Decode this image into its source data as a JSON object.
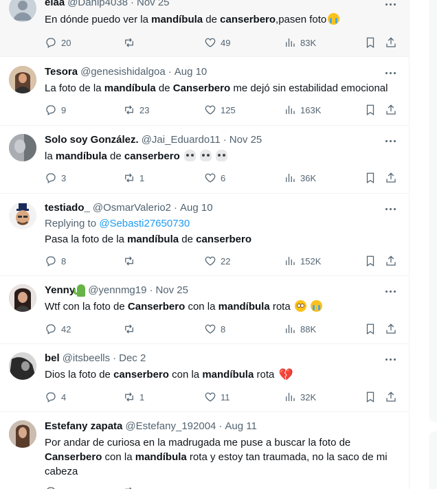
{
  "tweets": [
    {
      "name": "elaa",
      "handle": "@Danip4038",
      "date": "Nov 25",
      "text_parts": [
        "En dónde puedo ver la ",
        "mandíbula",
        " de ",
        "canserbero",
        ",pasen foto"
      ],
      "emoji": [
        "loudly-crying-face"
      ],
      "replies": "20",
      "retweets": "",
      "likes": "49",
      "views": "83K"
    },
    {
      "name": "Tesora",
      "handle": "@genesishidalgoa",
      "date": "Aug 10",
      "text_parts": [
        "La foto de la ",
        "mandíbula",
        " de ",
        "Canserbero",
        " me dejó sin estabilidad emocional"
      ],
      "replies": "9",
      "retweets": "23",
      "likes": "125",
      "views": "163K"
    },
    {
      "name": "Solo soy González.",
      "handle": "@Jai_Eduardo11",
      "date": "Nov 25",
      "text_parts": [
        "la ",
        "mandíbula",
        " de ",
        "canserbero",
        " "
      ],
      "emoji": [
        "skull",
        "skull",
        "skull"
      ],
      "replies": "3",
      "retweets": "1",
      "likes": "6",
      "views": "36K"
    },
    {
      "name": "testiado_",
      "handle": "@OsmarValerio2",
      "date": "Aug 10",
      "replying_label": "Replying to",
      "replying_to": "@Sebasti27650730",
      "text_parts": [
        "Pasa la foto de la ",
        "mandíbula",
        " de ",
        "canserbero",
        ""
      ],
      "replies": "8",
      "retweets": "",
      "likes": "22",
      "views": "152K"
    },
    {
      "name": "Yenny",
      "handle": "@yennmg19",
      "date": "Nov 25",
      "name_emoji": "cactus",
      "text_parts": [
        "Wtf con la foto de ",
        "Canserbero",
        " con la ",
        "mandíbula",
        " rota "
      ],
      "emoji": [
        "flushed-face",
        "loudly-crying-face"
      ],
      "replies": "42",
      "retweets": "",
      "likes": "8",
      "views": "88K"
    },
    {
      "name": "bel",
      "handle": "@itsbeells",
      "date": "Dec 2",
      "text_parts": [
        "Dios la foto de ",
        "canserbero",
        " con la ",
        "mandíbula",
        " rota "
      ],
      "emoji": [
        "broken-heart"
      ],
      "replies": "4",
      "retweets": "1",
      "likes": "11",
      "views": "32K"
    },
    {
      "name": "Estefany zapata",
      "handle": "@Estefany_192004",
      "date": "Aug 11",
      "text_parts": [
        "Por andar de curiosa en la madrugada me puse a buscar la foto de ",
        "Canserbero",
        " con la ",
        "mandíbula",
        " rota y estoy tan traumada, no la saco de mi cabeza"
      ],
      "replies": "",
      "retweets": "",
      "likes": "",
      "views": ""
    }
  ],
  "colors": {
    "text": "#0f1419",
    "muted": "#536471",
    "link": "#1d9bf0",
    "border": "#eff3f4",
    "highlight": "#f7f7f7"
  }
}
